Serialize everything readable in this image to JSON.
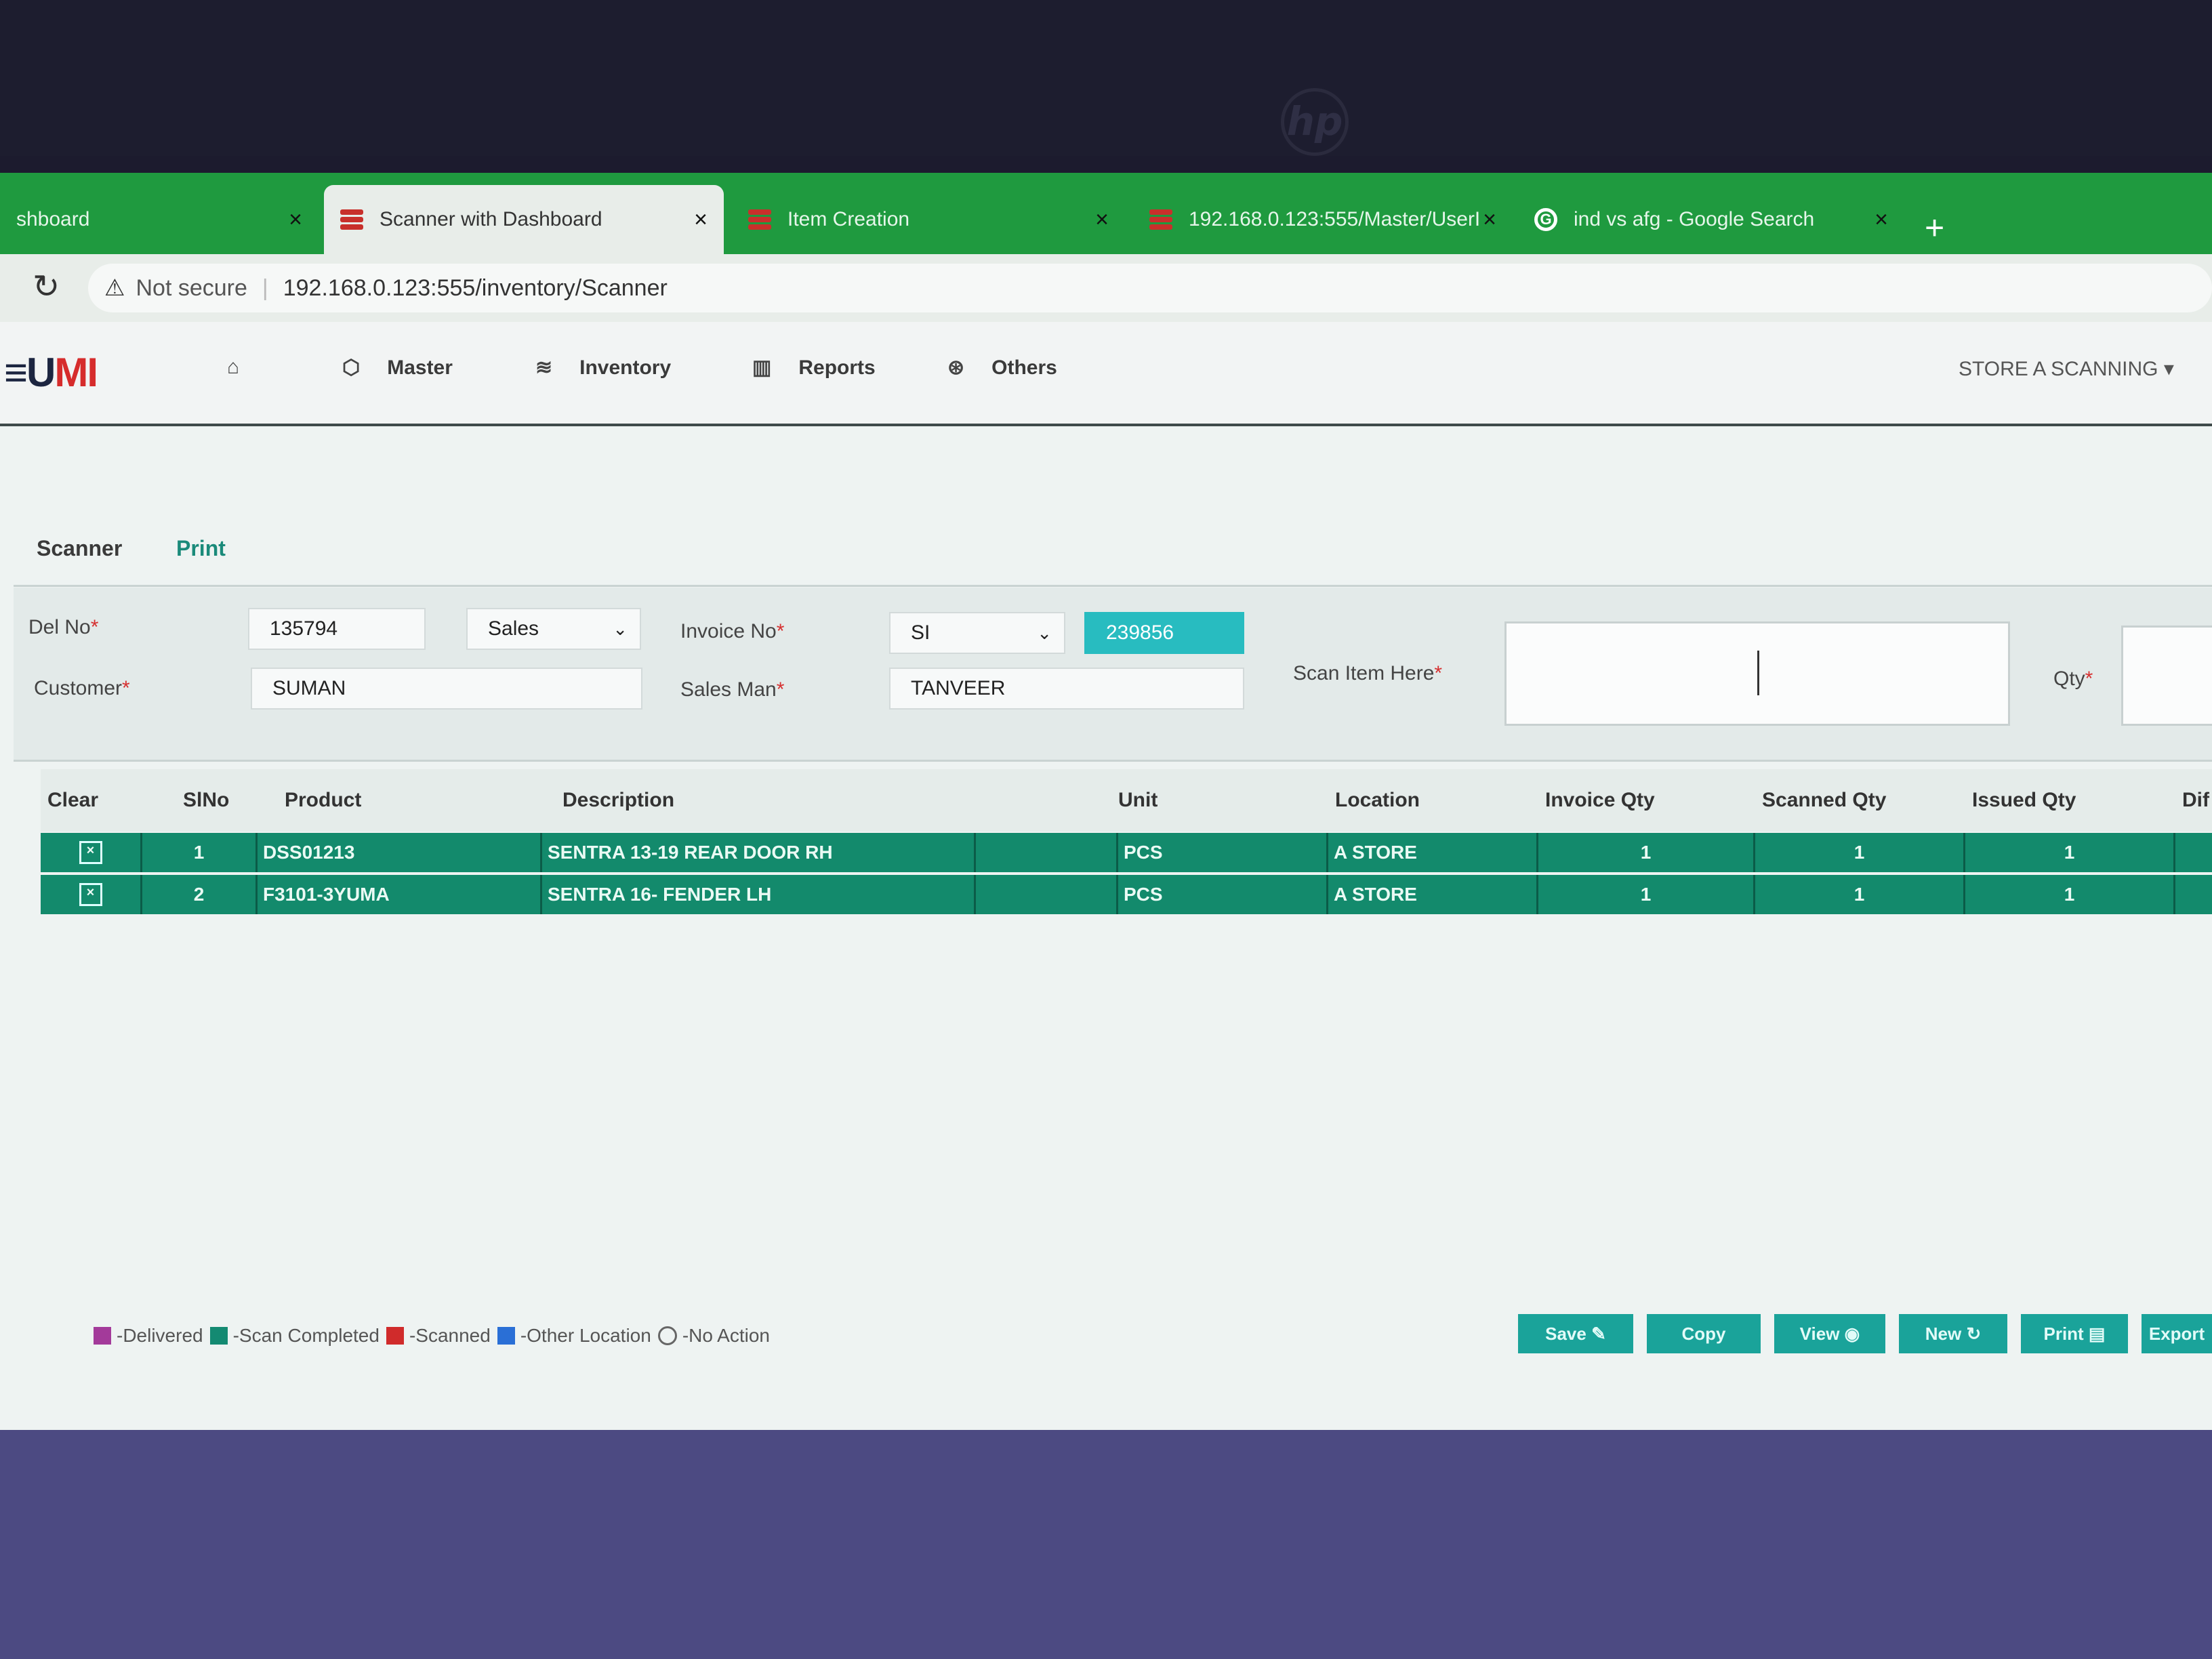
{
  "browser": {
    "tabs": [
      {
        "title": "shboard",
        "close": "×"
      },
      {
        "title": "Scanner with Dashboard",
        "close": "×"
      },
      {
        "title": "Item Creation",
        "close": "×"
      },
      {
        "title": "192.168.0.123:555/Master/UserI",
        "close": "×"
      },
      {
        "title": "ind vs afg - Google Search",
        "close": "×"
      }
    ],
    "new_tab": "+",
    "security_text": "Not secure",
    "url": "192.168.0.123:555/inventory/Scanner"
  },
  "app": {
    "logo_part1": "≡U",
    "logo_part2": "MI",
    "nav": [
      "Master",
      "Inventory",
      "Reports",
      "Others"
    ],
    "store_selector": "STORE A SCANNING ▾"
  },
  "subtabs": [
    "Scanner",
    "Print"
  ],
  "form": {
    "del_no_label": "Del No",
    "del_no": "135794",
    "type_select": "Sales",
    "invoice_no_label": "Invoice No",
    "invoice_prefix": "SI",
    "invoice_no": "239856",
    "customer_label": "Customer",
    "customer": "SUMAN",
    "sales_man_label": "Sales Man",
    "sales_man": "TANVEER",
    "scan_label": "Scan Item Here",
    "qty_label": "Qty",
    "required_mark": "*"
  },
  "table": {
    "columns": [
      "Clear",
      "SlNo",
      "Product",
      "Description",
      "Unit",
      "Location",
      "Invoice Qty",
      "Scanned Qty",
      "Issued Qty",
      "Dif"
    ],
    "rows": [
      {
        "slno": "1",
        "product": "DSS01213",
        "description": "SENTRA 13-19 REAR DOOR RH",
        "unit": "PCS",
        "location": "A STORE",
        "invoice_qty": "1",
        "scanned_qty": "1",
        "issued_qty": "1"
      },
      {
        "slno": "2",
        "product": "F3101-3YUMA",
        "description": "SENTRA 16- FENDER LH",
        "unit": "PCS",
        "location": "A STORE",
        "invoice_qty": "1",
        "scanned_qty": "1",
        "issued_qty": "1"
      }
    ],
    "row_color": "#138a6c"
  },
  "legend": [
    {
      "label": "-Delivered",
      "color": "#a33a9a"
    },
    {
      "label": "-Scan Completed",
      "color": "#148a72"
    },
    {
      "label": "-Scanned",
      "color": "#d02b2b"
    },
    {
      "label": "-Other Location",
      "color": "#2a6fd6"
    },
    {
      "label": "-No Action",
      "color": "none"
    }
  ],
  "actions": [
    "Save ✎",
    "Copy",
    "View ◉",
    "New ↻",
    "Print ▤",
    "Export"
  ]
}
